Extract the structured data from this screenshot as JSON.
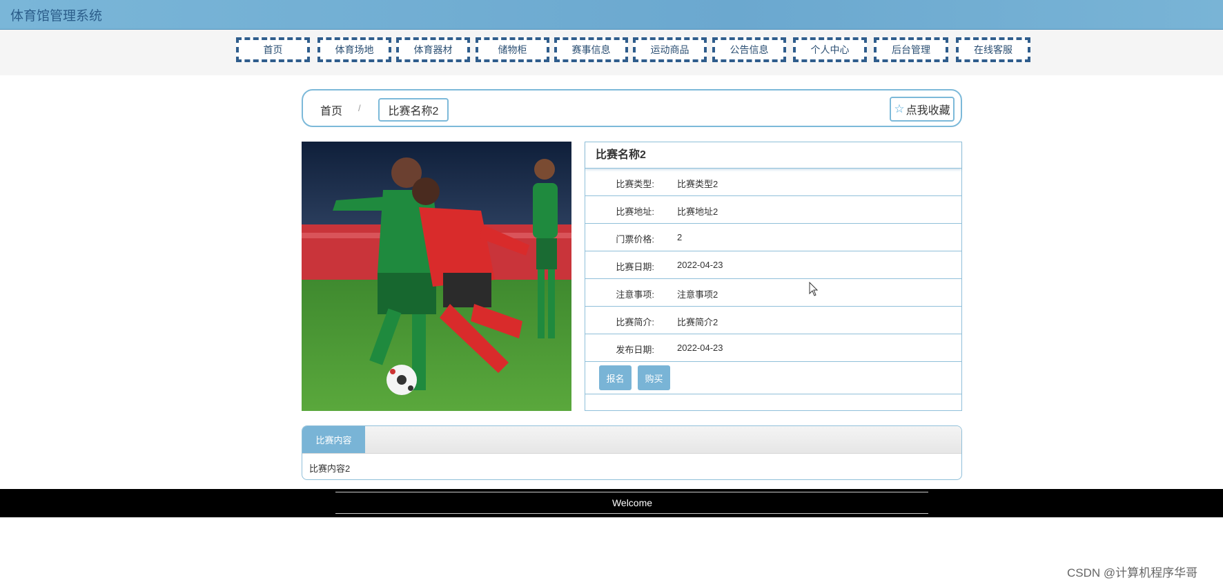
{
  "app": {
    "title": "体育馆管理系统"
  },
  "nav": {
    "items": [
      {
        "label": "首页"
      },
      {
        "label": "体育场地"
      },
      {
        "label": "体育器材"
      },
      {
        "label": "储物柜"
      },
      {
        "label": "赛事信息"
      },
      {
        "label": "运动商品"
      },
      {
        "label": "公告信息"
      },
      {
        "label": "个人中心"
      },
      {
        "label": "后台管理"
      },
      {
        "label": "在线客服"
      }
    ]
  },
  "breadcrumb": {
    "home": "首页",
    "separator": "/",
    "current": "比赛名称2"
  },
  "favorite": {
    "label": "点我收藏",
    "icon": "star-icon"
  },
  "detail": {
    "title": "比赛名称2",
    "fields": [
      {
        "label": "比赛类型:",
        "value": "比赛类型2"
      },
      {
        "label": "比赛地址:",
        "value": "比赛地址2"
      },
      {
        "label": "门票价格:",
        "value": "2"
      },
      {
        "label": "比赛日期:",
        "value": "2022-04-23"
      },
      {
        "label": "注意事项:",
        "value": "注意事项2"
      },
      {
        "label": "比赛简介:",
        "value": "比赛简介2"
      },
      {
        "label": "发布日期:",
        "value": "2022-04-23"
      }
    ],
    "actions": {
      "signup": "报名",
      "buy": "购买"
    }
  },
  "content": {
    "tab": "比赛内容",
    "text": "比赛内容2"
  },
  "footer": {
    "welcome": "Welcome"
  },
  "watermark": "CSDN @计算机程序华哥",
  "colors": {
    "accent": "#79b4d6",
    "nav_border": "#2f5d8c",
    "header_bg": "#6ba8cf"
  }
}
